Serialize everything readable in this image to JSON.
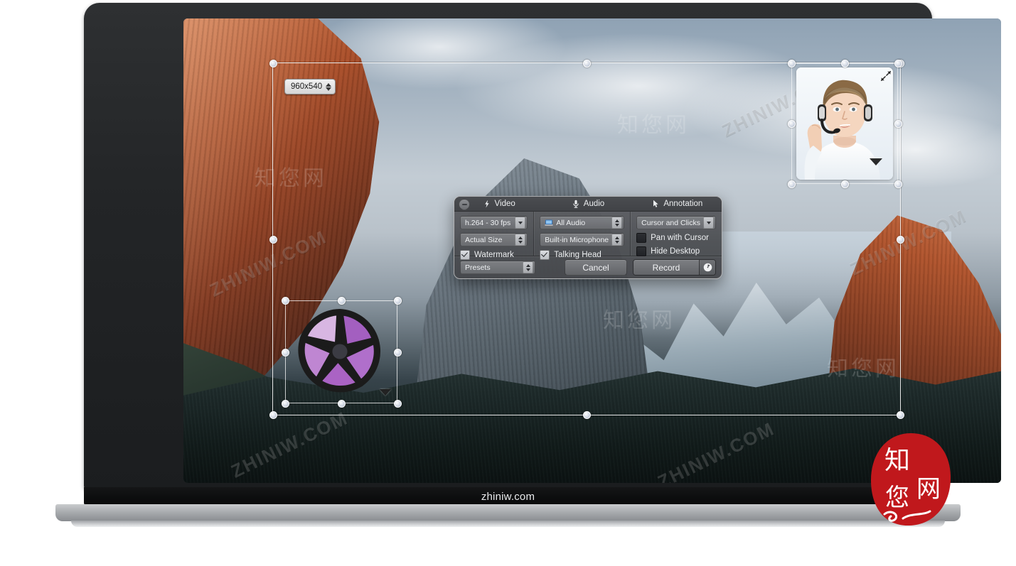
{
  "device": {
    "bezel_label": "zhiniw.com",
    "type": "laptop-mockup"
  },
  "capture": {
    "size_badge": "960x540",
    "stepper_icon": "stepper-up-down-icon"
  },
  "watermark_object": {
    "name": "shutter-logo-watermark",
    "color": "#a35fc0",
    "menu_icon": "triangle-down-icon"
  },
  "talking_head": {
    "name": "talking-head-preview",
    "expand_icon": "expand-arrows-icon",
    "menu_icon": "triangle-down-icon"
  },
  "panel": {
    "close_button_icon": "minimize-circle-icon",
    "columns": [
      {
        "title": "Video",
        "icon": "lightning-bolt-icon",
        "controls": [
          {
            "kind": "select",
            "name": "video-codec-select",
            "value": "h.264 - 30 fps",
            "arrow": "chevron-down-icon"
          },
          {
            "kind": "select",
            "name": "video-size-select",
            "value": "Actual Size",
            "arrow": "up-down-arrows-icon"
          },
          {
            "kind": "checkbox",
            "name": "watermark-checkbox",
            "label": "Watermark",
            "checked": true
          }
        ]
      },
      {
        "title": "Audio",
        "icon": "microphone-icon",
        "controls": [
          {
            "kind": "select",
            "name": "audio-source-select",
            "value": "All Audio",
            "arrow": "up-down-arrows-icon",
            "leading_icon": "computer-audio-icon"
          },
          {
            "kind": "select",
            "name": "microphone-select",
            "value": "Built-in Microphone",
            "arrow": "up-down-arrows-icon"
          },
          {
            "kind": "checkbox",
            "name": "talking-head-checkbox",
            "label": "Talking Head",
            "checked": true
          }
        ]
      },
      {
        "title": "Annotation",
        "icon": "cursor-arrow-icon",
        "controls": [
          {
            "kind": "select",
            "name": "annotation-mode-select",
            "value": "Cursor and Clicks",
            "arrow": "chevron-down-icon"
          },
          {
            "kind": "checkbox",
            "name": "pan-with-cursor-checkbox",
            "label": "Pan with Cursor",
            "checked": false
          },
          {
            "kind": "checkbox",
            "name": "hide-desktop-checkbox",
            "label": "Hide Desktop",
            "checked": false
          }
        ]
      }
    ],
    "footer": {
      "presets_label": "Presets",
      "presets_arrow": "up-down-arrows-icon",
      "cancel_label": "Cancel",
      "record_label": "Record",
      "record_timer_icon": "clock-icon"
    }
  },
  "watermarks": {
    "diagonal_text": "ZHINIW.COM",
    "cn_text": "知您网",
    "seal_line1": "知",
    "seal_line2": "网",
    "seal_line3": "您",
    "seal_color": "#c0181c"
  }
}
